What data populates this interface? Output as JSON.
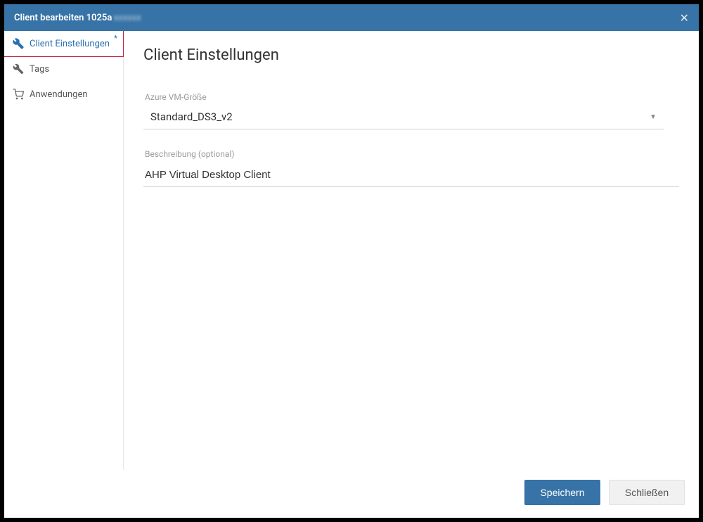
{
  "header": {
    "title_prefix": "Client bearbeiten 1025a",
    "title_blurred": "xxxxxx"
  },
  "sidebar": {
    "items": [
      {
        "label": "Client Einstellungen",
        "active": true,
        "modified": true
      },
      {
        "label": "Tags",
        "active": false,
        "modified": false
      },
      {
        "label": "Anwendungen",
        "active": false,
        "modified": false
      }
    ]
  },
  "content": {
    "page_title": "Client Einstellungen",
    "vm_size_label": "Azure VM-Größe",
    "vm_size_value": "Standard_DS3_v2",
    "description_label": "Beschreibung (optional)",
    "description_value": "AHP Virtual Desktop Client"
  },
  "footer": {
    "save_label": "Speichern",
    "close_label": "Schließen"
  }
}
